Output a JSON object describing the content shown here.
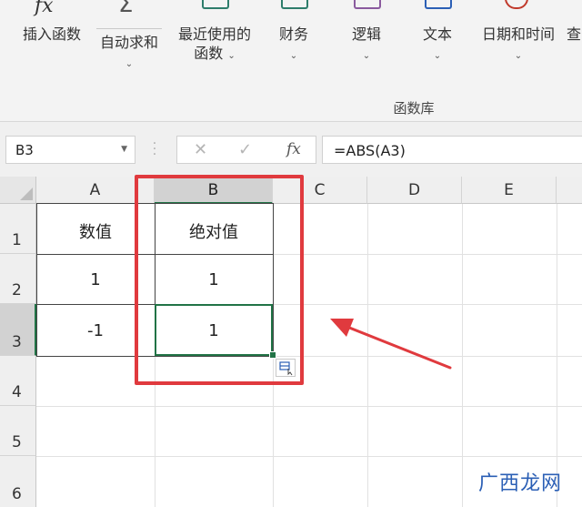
{
  "ribbon": {
    "buttons": [
      {
        "label": "插入函数",
        "icon": "fx-icon"
      },
      {
        "label": "自动求和",
        "icon": "sigma-icon"
      },
      {
        "label": "最近使用的",
        "label2": "函数",
        "icon": "star-book-icon"
      },
      {
        "label": "财务",
        "icon": "finance-book-icon"
      },
      {
        "label": "逻辑",
        "icon": "logic-book-icon"
      },
      {
        "label": "文本",
        "icon": "text-book-icon"
      },
      {
        "label": "日期和时间",
        "icon": "clock-book-icon"
      },
      {
        "label": "查",
        "icon": "lookup-icon"
      }
    ],
    "group_label": "函数库"
  },
  "formula_bar": {
    "name_box": "B3",
    "fx_symbol": "fx",
    "formula": "=ABS(A3)"
  },
  "sheet": {
    "columns": [
      "A",
      "B",
      "C",
      "D",
      "E"
    ],
    "rows": [
      "1",
      "2",
      "3",
      "4",
      "5",
      "6"
    ],
    "cells": {
      "A1": "数值",
      "B1": "绝对值",
      "A2": "1",
      "B2": "1",
      "A3": "-1",
      "B3": "1"
    },
    "selected_cell": "B3"
  },
  "annotations": {
    "highlight_color": "#e03a3e",
    "accent_color": "#217346"
  },
  "watermark": "广西龙网"
}
